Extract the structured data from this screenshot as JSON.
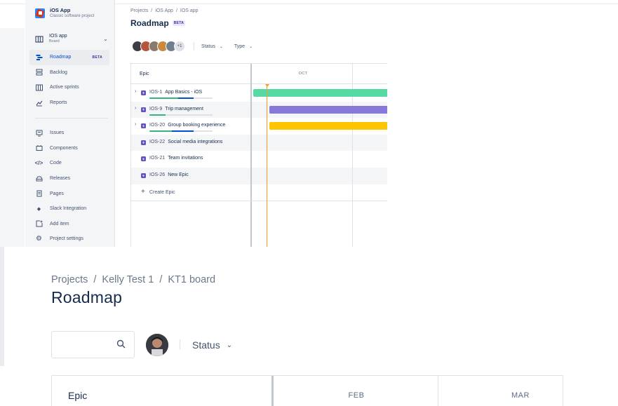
{
  "sidebar": {
    "project_name": "iOS App",
    "project_type": "Classic software project",
    "board_title": "IOS app",
    "board_sub": "Board",
    "nav_top": [
      {
        "label": "Roadmap",
        "badge": "BETA",
        "icon": "roadmap-icon",
        "active": true
      },
      {
        "label": "Backlog",
        "icon": "backlog-icon"
      },
      {
        "label": "Active sprints",
        "icon": "sprints-icon"
      },
      {
        "label": "Reports",
        "icon": "reports-icon"
      }
    ],
    "nav_bottom": [
      {
        "label": "Issues",
        "icon": "issues-icon"
      },
      {
        "label": "Components",
        "icon": "components-icon"
      },
      {
        "label": "Code",
        "icon": "code-icon"
      },
      {
        "label": "Releases",
        "icon": "releases-icon"
      },
      {
        "label": "Pages",
        "icon": "pages-icon"
      },
      {
        "label": "Slack Integration",
        "icon": "slack-icon"
      },
      {
        "label": "Add item",
        "icon": "add-item-icon"
      },
      {
        "label": "Project settings",
        "icon": "settings-icon"
      }
    ]
  },
  "top": {
    "breadcrumbs": [
      "Projects",
      "iOS App",
      "IOS app"
    ],
    "title": "Roadmap",
    "title_badge": "BETA",
    "avatars_more": "+1",
    "filters": [
      "Status",
      "Type"
    ],
    "epic_header": "Epic",
    "month": "OCT",
    "epics": [
      {
        "key": "IOS-1",
        "summary": "App Basics - iOS",
        "expandable": true,
        "progress": {
          "done": 0.45,
          "in_progress": 0.25
        },
        "bar_color": "#57d9a3"
      },
      {
        "key": "IOS-9",
        "summary": "Trip management",
        "expandable": true,
        "progress": {
          "done": 0.25,
          "in_progress": 0.0
        },
        "bar_color": "#8777d9"
      },
      {
        "key": "IOS-20",
        "summary": "Group booking experience",
        "expandable": true,
        "progress": {
          "done": 0.35,
          "in_progress": 0.35
        },
        "bar_color": "#ffc400"
      },
      {
        "key": "IOS-22",
        "summary": "Social media integrations",
        "expandable": false
      },
      {
        "key": "IOS-21",
        "summary": "Team invitations",
        "expandable": false
      },
      {
        "key": "IOS-26",
        "summary": "New Epic",
        "expandable": false
      }
    ],
    "create_epic": "Create Epic"
  },
  "bottom": {
    "breadcrumbs": [
      "Projects",
      "Kelly Test 1",
      "KT1 board"
    ],
    "title": "Roadmap",
    "search_placeholder": "",
    "status_filter": "Status",
    "epic_header": "Epic",
    "months": [
      "FEB",
      "MAR"
    ]
  }
}
